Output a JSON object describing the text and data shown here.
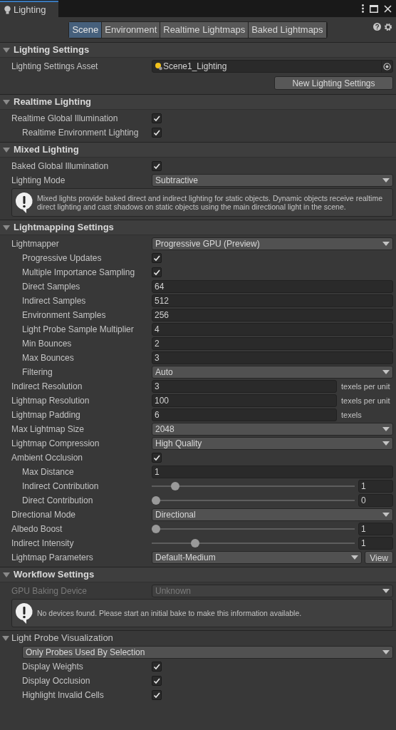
{
  "window": {
    "title": "Lighting"
  },
  "tabs": [
    {
      "label": "Scene",
      "selected": true
    },
    {
      "label": "Environment",
      "selected": false
    },
    {
      "label": "Realtime Lightmaps",
      "selected": false
    },
    {
      "label": "Baked Lightmaps",
      "selected": false
    }
  ],
  "sections": [
    {
      "kind": "section",
      "title": "Lighting Settings",
      "expanded": true,
      "rows": [
        {
          "kind": "asset",
          "label": "Lighting Settings Asset",
          "value": "Scene1_Lighting"
        },
        {
          "kind": "button",
          "label": "New Lighting Settings"
        }
      ]
    },
    {
      "kind": "section",
      "title": "Realtime Lighting",
      "expanded": true,
      "rows": [
        {
          "kind": "checkbox",
          "label": "Realtime Global Illumination",
          "checked": true,
          "children": [
            {
              "kind": "checkbox",
              "label": "Realtime Environment Lighting",
              "checked": true
            }
          ]
        }
      ]
    },
    {
      "kind": "section",
      "title": "Mixed Lighting",
      "expanded": true,
      "rows": [
        {
          "kind": "checkbox",
          "label": "Baked Global Illumination",
          "checked": true
        },
        {
          "kind": "dropdown",
          "label": "Lighting Mode",
          "value": "Subtractive"
        },
        {
          "kind": "help",
          "text": "Mixed lights provide baked direct and indirect lighting for static objects. Dynamic objects receive realtime direct lighting and cast shadows on static objects using the main directional light in the scene."
        }
      ]
    },
    {
      "kind": "section",
      "title": "Lightmapping Settings",
      "expanded": true,
      "rows": [
        {
          "kind": "dropdown",
          "label": "Lightmapper",
          "value": "Progressive GPU (Preview)",
          "children": [
            {
              "kind": "checkbox",
              "label": "Progressive Updates",
              "checked": true
            },
            {
              "kind": "checkbox",
              "label": "Multiple Importance Sampling",
              "checked": true
            },
            {
              "kind": "number",
              "label": "Direct Samples",
              "value": "64"
            },
            {
              "kind": "number",
              "label": "Indirect Samples",
              "value": "512"
            },
            {
              "kind": "number",
              "label": "Environment Samples",
              "value": "256"
            },
            {
              "kind": "number",
              "label": "Light Probe Sample Multiplier",
              "value": "4"
            },
            {
              "kind": "number",
              "label": "Min Bounces",
              "value": "2"
            },
            {
              "kind": "number",
              "label": "Max Bounces",
              "value": "3"
            },
            {
              "kind": "dropdown",
              "label": "Filtering",
              "value": "Auto"
            }
          ]
        },
        {
          "kind": "number",
          "label": "Indirect Resolution",
          "value": "3",
          "unit": "texels per unit"
        },
        {
          "kind": "number",
          "label": "Lightmap Resolution",
          "value": "100",
          "unit": "texels per unit"
        },
        {
          "kind": "number",
          "label": "Lightmap Padding",
          "value": "6",
          "unit": "texels"
        },
        {
          "kind": "dropdown",
          "label": "Max Lightmap Size",
          "value": "2048"
        },
        {
          "kind": "dropdown",
          "label": "Lightmap Compression",
          "value": "High Quality"
        },
        {
          "kind": "checkbox",
          "label": "Ambient Occlusion",
          "checked": true,
          "children": [
            {
              "kind": "number",
              "label": "Max Distance",
              "value": "1"
            },
            {
              "kind": "slider",
              "label": "Indirect Contribution",
              "level": 0.1,
              "value": "1"
            },
            {
              "kind": "slider",
              "label": "Direct Contribution",
              "level": 0,
              "value": "0"
            }
          ]
        },
        {
          "kind": "dropdown",
          "label": "Directional Mode",
          "value": "Directional"
        },
        {
          "kind": "slider",
          "label": "Albedo Boost",
          "level": 0,
          "value": "1"
        },
        {
          "kind": "slider",
          "label": "Indirect Intensity",
          "level": 0.2,
          "value": "1"
        },
        {
          "kind": "dropdown",
          "label": "Lightmap Parameters",
          "value": "Default-Medium",
          "button": "View"
        }
      ]
    },
    {
      "kind": "section",
      "title": "Workflow Settings",
      "expanded": true,
      "rows": [
        {
          "kind": "dropdown",
          "label": "GPU Baking Device",
          "value": "Unknown",
          "disabled": true
        },
        {
          "kind": "help",
          "text": "No devices found. Please start an initial bake to make this information available."
        }
      ]
    },
    {
      "kind": "foldout",
      "title": "Light Probe Visualization",
      "expanded": true,
      "dropdown": "Only Probes Used By Selection",
      "rows": [
        {
          "kind": "checkbox",
          "label": "Display Weights",
          "checked": true
        },
        {
          "kind": "checkbox",
          "label": "Display Occlusion",
          "checked": true
        },
        {
          "kind": "checkbox",
          "label": "Highlight Invalid Cells",
          "checked": true
        }
      ]
    }
  ]
}
